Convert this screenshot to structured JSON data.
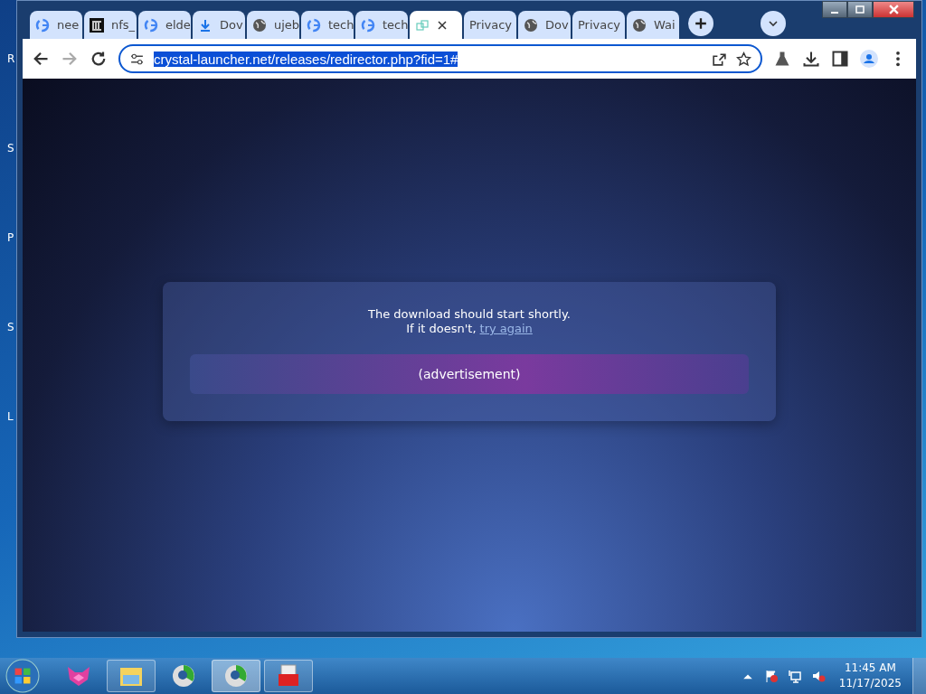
{
  "desktop": {
    "icon_labels": [
      "R",
      "S",
      "P",
      "S",
      "L"
    ]
  },
  "browser": {
    "tabs": [
      {
        "title": "nee",
        "selected": false
      },
      {
        "title": "nfs_",
        "selected": false
      },
      {
        "title": "elde",
        "selected": false
      },
      {
        "title": "Dov",
        "selected": false
      },
      {
        "title": "ujeb",
        "selected": false
      },
      {
        "title": "tech",
        "selected": false
      },
      {
        "title": "tech",
        "selected": false
      },
      {
        "selected": true
      },
      {
        "title": "Privacy",
        "selected": false
      },
      {
        "title": "Dov",
        "selected": false
      },
      {
        "title": "Privacy",
        "selected": false
      },
      {
        "title": "Wai",
        "selected": false
      }
    ],
    "address": "crystal-launcher.net/releases/redirector.php?fid=1#"
  },
  "page": {
    "message": "The download should start shortly.",
    "retry_prefix": "If it doesn't,",
    "retry_link": "try again",
    "ad": "(advertisement)"
  },
  "taskbar": {
    "items": [
      {
        "kind": "fox",
        "running": false,
        "selected": false
      },
      {
        "kind": "folder",
        "running": true,
        "selected": false
      },
      {
        "kind": "browser",
        "running": false,
        "selected": false
      },
      {
        "kind": "browser",
        "running": true,
        "selected": true
      },
      {
        "kind": "toolbox",
        "running": true,
        "selected": false
      }
    ],
    "time": "11:45 AM",
    "date": "11/17/2025"
  }
}
